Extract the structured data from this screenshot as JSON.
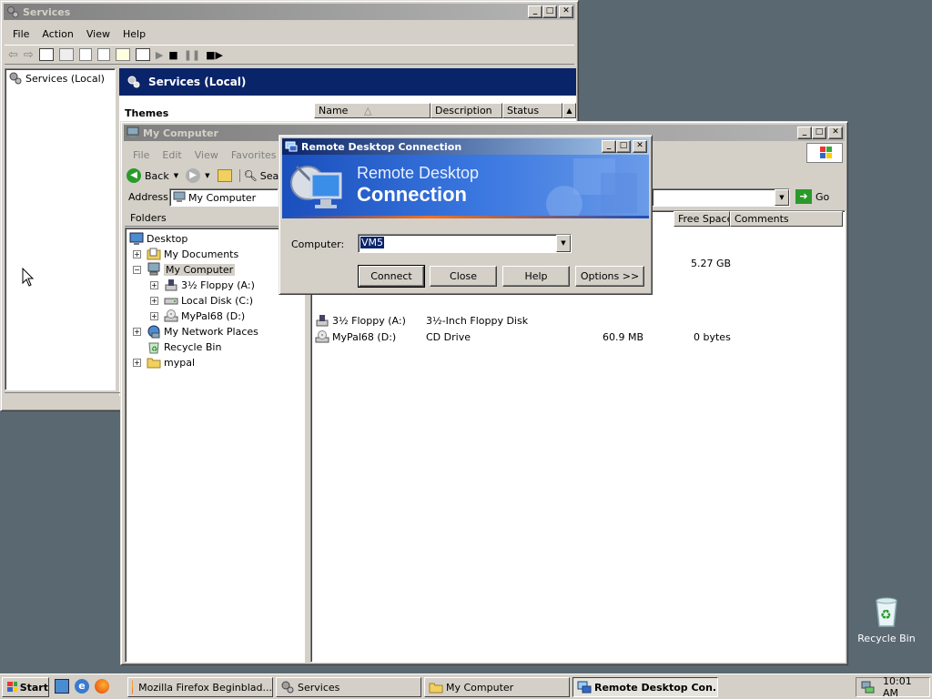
{
  "services_window": {
    "title": "Services",
    "menu": [
      "File",
      "Action",
      "View",
      "Help"
    ],
    "tree_root": "Services (Local)",
    "panel_title": "Services (Local)",
    "themes_label": "Themes",
    "columns": [
      "Name",
      "Description",
      "Status"
    ]
  },
  "explorer_window": {
    "title": "My Computer",
    "menu": [
      "File",
      "Edit",
      "View",
      "Favorites"
    ],
    "back_label": "Back",
    "search_label": "Sea",
    "address_label": "Address",
    "address_value": "My Computer",
    "go_label": "Go",
    "folders_label": "Folders",
    "tree": {
      "desktop": "Desktop",
      "my_documents": "My Documents",
      "my_computer": "My Computer",
      "floppy": "3½ Floppy (A:)",
      "local_disk": "Local Disk (C:)",
      "mypal": "MyPal68 (D:)",
      "network": "My Network Places",
      "recycle": "Recycle Bin",
      "mypal_folder": "mypal"
    },
    "columns": {
      "free_space": "Free Space",
      "comments": "Comments"
    },
    "local_free": "5.27 GB",
    "rows": [
      {
        "name": "3½ Floppy (A:)",
        "type": "3½-Inch Floppy Disk",
        "size": "",
        "free": ""
      },
      {
        "name": "MyPal68 (D:)",
        "type": "CD Drive",
        "size": "60.9 MB",
        "free": "0 bytes"
      }
    ]
  },
  "rdc_dialog": {
    "title": "Remote Desktop Connection",
    "banner_line1": "Remote Desktop",
    "banner_line2": "Connection",
    "computer_label": "Computer:",
    "computer_value": "VM5",
    "buttons": {
      "connect": "Connect",
      "close": "Close",
      "help": "Help",
      "options": "Options >>"
    }
  },
  "desktop": {
    "recycle_bin_label": "Recycle Bin"
  },
  "taskbar": {
    "start_label": "Start",
    "items": [
      "Mozilla Firefox Beginblad...",
      "Services",
      "My Computer",
      "Remote Desktop Con..."
    ],
    "clock": "10:01 AM"
  }
}
